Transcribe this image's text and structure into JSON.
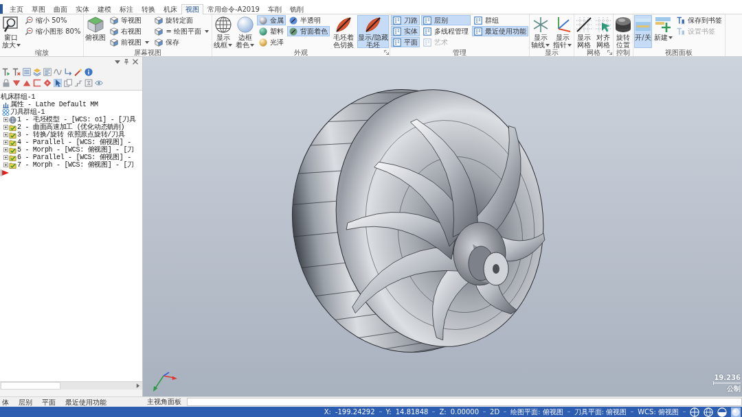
{
  "menu_tabs": [
    {
      "label": "主页",
      "selected": false
    },
    {
      "label": "草图",
      "selected": false
    },
    {
      "label": "曲面",
      "selected": false
    },
    {
      "label": "实体",
      "selected": false
    },
    {
      "label": "建模",
      "selected": false
    },
    {
      "label": "标注",
      "selected": false
    },
    {
      "label": "转换",
      "selected": false
    },
    {
      "label": "机床",
      "selected": false
    },
    {
      "label": "视图",
      "selected": true
    },
    {
      "label": "常用命令-A2019",
      "selected": false
    },
    {
      "label": "车削",
      "selected": false
    },
    {
      "label": "铣削",
      "selected": false
    }
  ],
  "ribbon_groups": [
    {
      "label": "缩放",
      "launcher": false,
      "items": [
        {
          "kind": "large",
          "label": "窗口放大",
          "dropdown": true,
          "on": false,
          "disabled": false
        },
        {
          "kind": "small",
          "label": "缩小 50%",
          "dropdown": false,
          "on": false,
          "disabled": false
        },
        {
          "kind": "small",
          "label": "缩小图形 80%",
          "dropdown": false,
          "on": false,
          "disabled": false
        }
      ]
    },
    {
      "label": "屏幕视图",
      "launcher": false,
      "items": [
        {
          "kind": "large",
          "label": "俯视图",
          "dropdown": false,
          "on": false,
          "disabled": false
        },
        {
          "kind": "small",
          "label": "等视图",
          "dropdown": false,
          "on": false,
          "disabled": false
        },
        {
          "kind": "small",
          "label": "右视图",
          "dropdown": false,
          "on": false,
          "disabled": false
        },
        {
          "kind": "small",
          "label": "前视图",
          "dropdown": true,
          "on": false,
          "disabled": false
        },
        {
          "kind": "small",
          "label": "旋转定面",
          "dropdown": false,
          "on": false,
          "disabled": false
        },
        {
          "kind": "small",
          "label": "= 绘图平面",
          "dropdown": true,
          "on": false,
          "disabled": false
        },
        {
          "kind": "small",
          "label": "保存",
          "dropdown": false,
          "on": false,
          "disabled": false
        }
      ]
    },
    {
      "label": "外观",
      "launcher": true,
      "items": [
        {
          "kind": "large",
          "label": "显示线框",
          "dropdown": true,
          "on": false,
          "disabled": false
        },
        {
          "kind": "large",
          "label": "边框着色",
          "dropdown": true,
          "on": false,
          "disabled": false
        },
        {
          "kind": "small",
          "label": "金属",
          "dropdown": false,
          "on": true,
          "disabled": false
        },
        {
          "kind": "small",
          "label": "塑料",
          "dropdown": false,
          "on": false,
          "disabled": false
        },
        {
          "kind": "small",
          "label": "光泽",
          "dropdown": false,
          "on": false,
          "disabled": false
        },
        {
          "kind": "small",
          "label": "半透明",
          "dropdown": false,
          "on": false,
          "disabled": false
        },
        {
          "kind": "small",
          "label": "背面着色",
          "dropdown": false,
          "on": true,
          "disabled": false
        },
        {
          "kind": "large",
          "label": "毛坯着色切换",
          "dropdown": false,
          "on": false,
          "disabled": false
        },
        {
          "kind": "large",
          "label": "显示/隐藏毛坯",
          "dropdown": false,
          "on": true,
          "disabled": false
        }
      ]
    },
    {
      "label": "管理",
      "launcher": false,
      "items": [
        {
          "kind": "small",
          "label": "刀路",
          "dropdown": false,
          "on": true,
          "disabled": false
        },
        {
          "kind": "small",
          "label": "实体",
          "dropdown": false,
          "on": true,
          "disabled": false
        },
        {
          "kind": "small",
          "label": "平面",
          "dropdown": false,
          "on": true,
          "disabled": false
        },
        {
          "kind": "small",
          "label": "层别",
          "dropdown": false,
          "on": true,
          "disabled": false
        },
        {
          "kind": "small",
          "label": "多线程管理",
          "dropdown": false,
          "on": false,
          "disabled": false
        },
        {
          "kind": "small",
          "label": "艺术",
          "dropdown": false,
          "on": false,
          "disabled": true
        },
        {
          "kind": "small",
          "label": "群组",
          "dropdown": false,
          "on": false,
          "disabled": false
        },
        {
          "kind": "small",
          "label": "最近使用功能",
          "dropdown": false,
          "on": true,
          "disabled": false
        }
      ]
    },
    {
      "label": "显示",
      "launcher": false,
      "items": [
        {
          "kind": "large",
          "label": "显示轴线",
          "dropdown": true,
          "on": false,
          "disabled": false
        },
        {
          "kind": "large",
          "label": "显示指针",
          "dropdown": true,
          "on": false,
          "disabled": false
        }
      ]
    },
    {
      "label": "网格",
      "launcher": true,
      "items": [
        {
          "kind": "large",
          "label": "显示网格",
          "dropdown": false,
          "on": false,
          "disabled": false
        },
        {
          "kind": "large",
          "label": "对齐网格",
          "dropdown": false,
          "on": false,
          "disabled": false
        }
      ]
    },
    {
      "label": "控制",
      "launcher": false,
      "items": [
        {
          "kind": "large",
          "label": "旋转位置",
          "dropdown": false,
          "on": false,
          "disabled": false
        }
      ]
    },
    {
      "label": "视图面板",
      "launcher": false,
      "items": [
        {
          "kind": "large",
          "label": "开/关",
          "dropdown": false,
          "on": true,
          "disabled": false
        },
        {
          "kind": "large",
          "label": "新建",
          "dropdown": true,
          "on": false,
          "disabled": false
        },
        {
          "kind": "small",
          "label": "保存到书签",
          "dropdown": false,
          "on": false,
          "disabled": false
        },
        {
          "kind": "small",
          "label": "设置书签",
          "dropdown": false,
          "on": false,
          "disabled": true
        }
      ]
    }
  ],
  "toolpath_panel": {
    "toolbar": [
      [
        {
          "selected": false
        },
        {
          "selected": false
        },
        {
          "selected": false
        },
        {
          "selected": false
        },
        {
          "selected": false
        },
        {
          "selected": false
        },
        {
          "selected": false
        },
        {
          "selected": false
        },
        {
          "selected": false
        }
      ],
      [
        {
          "selected": false
        },
        {
          "selected": false
        },
        {
          "selected": false
        },
        {
          "selected": false
        },
        {
          "selected": false
        },
        {
          "selected": true
        },
        {
          "selected": false
        },
        {
          "selected": false
        },
        {
          "selected": false
        },
        {
          "selected": false
        }
      ]
    ],
    "tree": [
      {
        "label": "机床群组-1",
        "children": [
          {
            "label": "属性 - Lathe Default MM",
            "kind": "properties"
          },
          {
            "label": "刀具群组-1",
            "kind": "group",
            "children": [
              {
                "label": "1 - 毛坯模型 - [WCS: o1] - [刀具",
                "kind": "stock",
                "expanded": false
              },
              {
                "label": "2 - 曲面高速加工 (优化动态铣削)",
                "kind": "toolpath",
                "expanded": false
              },
              {
                "label": "3 - 转换/旋转 依照原点旋转/刀具",
                "kind": "toolpath",
                "expanded": false
              },
              {
                "label": "4 - Parallel - [WCS: 俯视图] -",
                "kind": "toolpath",
                "expanded": false
              },
              {
                "label": "5 - Morph - [WCS: 俯视图] - [刀",
                "kind": "toolpath",
                "expanded": false
              },
              {
                "label": "6 - Parallel - [WCS: 俯视图] -",
                "kind": "toolpath",
                "expanded": false
              },
              {
                "label": "7 - Morph - [WCS: 俯视图] - [刀",
                "kind": "toolpath",
                "expanded": false
              }
            ]
          }
        ]
      }
    ],
    "tabs": [
      {
        "label": "体",
        "selected": false
      },
      {
        "label": "层别",
        "selected": false
      },
      {
        "label": "平面",
        "selected": false
      },
      {
        "label": "最近使用功能",
        "selected": false
      }
    ]
  },
  "viewport": {
    "scale_value": "19.236",
    "scale_unit": "公制"
  },
  "view_panel": {
    "label": "主视角面板"
  },
  "status_bar": {
    "coordinates": [
      {
        "label": "X:",
        "value": "-199.24292"
      },
      {
        "label": "Y:",
        "value": "14.81848"
      },
      {
        "label": "Z:",
        "value": "0.00000"
      }
    ],
    "planes": [
      "2D",
      "绘图平面: 俯视图",
      "刀具平面: 俯视图",
      "WCS: 俯视图"
    ],
    "view_modes": [
      {
        "selected": false
      },
      {
        "selected": false
      },
      {
        "selected": false
      },
      {
        "selected": true
      }
    ]
  }
}
